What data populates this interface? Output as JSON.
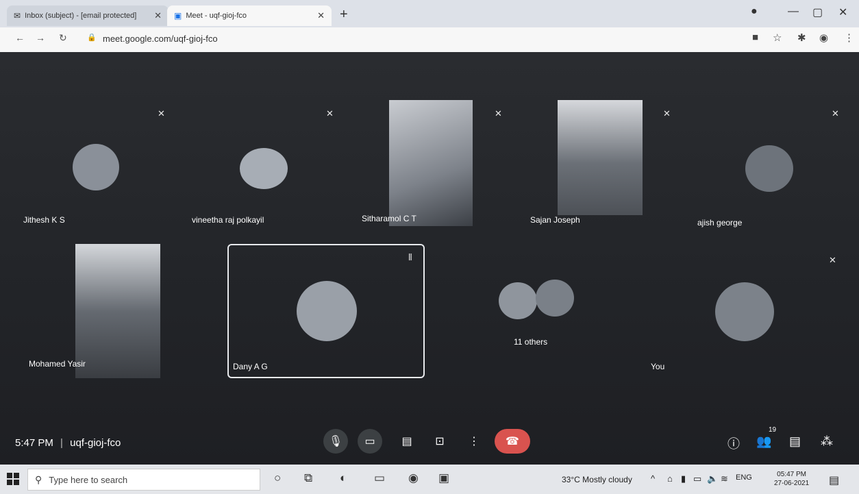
{
  "browser": {
    "tabs": [
      {
        "label": "Inbox (subject) - [email protected]",
        "icon": "gmail-icon"
      },
      {
        "label": "Meet - uqf-gioj-fco",
        "icon": "meet-icon"
      }
    ],
    "new_tab": "+",
    "url": "meet.google.com/uqf-gioj-fco"
  },
  "participants": [
    {
      "name": "Jithesh K S"
    },
    {
      "name": "vineetha raj polkayil"
    },
    {
      "name": "Sitharamol C T"
    },
    {
      "name": "Sajan Joseph"
    },
    {
      "name": "ajish george"
    },
    {
      "name": "Mohamed Yasir"
    },
    {
      "name": "Dany A G"
    },
    {
      "name": "11 others"
    },
    {
      "name": "You"
    }
  ],
  "bottom_bar": {
    "time": "5:47 PM",
    "separator": "|",
    "meeting_code": "uqf-gioj-fco",
    "people_count": "19"
  },
  "taskbar": {
    "search_placeholder": "Type here to search",
    "weather": "33°C Mostly cloudy",
    "language": "ENG",
    "time": "05:47 PM",
    "date": "27-06-2021"
  }
}
